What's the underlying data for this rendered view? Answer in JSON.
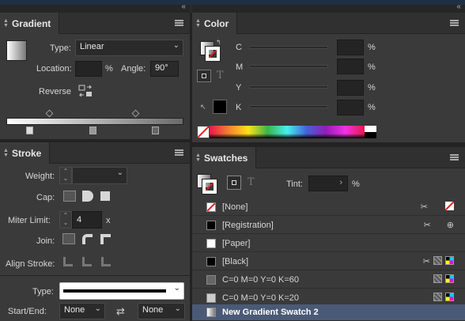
{
  "gradient": {
    "tab": "Gradient",
    "type_label": "Type:",
    "type_value": "Linear",
    "location_label": "Location:",
    "location_value": "",
    "location_unit": "%",
    "angle_label": "Angle:",
    "angle_value": "90°",
    "reverse_label": "Reverse"
  },
  "stroke": {
    "tab": "Stroke",
    "weight_label": "Weight:",
    "weight_value": "",
    "cap_label": "Cap:",
    "miter_label": "Miter Limit:",
    "miter_value": "4",
    "miter_unit": "x",
    "join_label": "Join:",
    "align_label": "Align Stroke:",
    "type_label": "Type:",
    "startend_label": "Start/End:",
    "start_value": "None",
    "end_value": "None"
  },
  "color": {
    "tab": "Color",
    "channels": [
      {
        "label": "C",
        "value": "",
        "unit": "%"
      },
      {
        "label": "M",
        "value": "",
        "unit": "%"
      },
      {
        "label": "Y",
        "value": "",
        "unit": "%"
      },
      {
        "label": "K",
        "value": "",
        "unit": "%"
      }
    ]
  },
  "swatches": {
    "tab": "Swatches",
    "tint_label": "Tint:",
    "tint_value": "",
    "tint_unit": "%",
    "items": [
      {
        "name": "[None]",
        "color": "#ffffff"
      },
      {
        "name": "[Registration]",
        "color": "#000000"
      },
      {
        "name": "[Paper]",
        "color": "#ffffff"
      },
      {
        "name": "[Black]",
        "color": "#000000"
      },
      {
        "name": "C=0 M=0 Y=0 K=60",
        "color": "#666666"
      },
      {
        "name": "C=0 M=0 Y=0 K=20",
        "color": "#cccccc"
      },
      {
        "name": "New Gradient Swatch 2",
        "color": "gradient"
      }
    ]
  },
  "collapse_glyph": "‹‹"
}
